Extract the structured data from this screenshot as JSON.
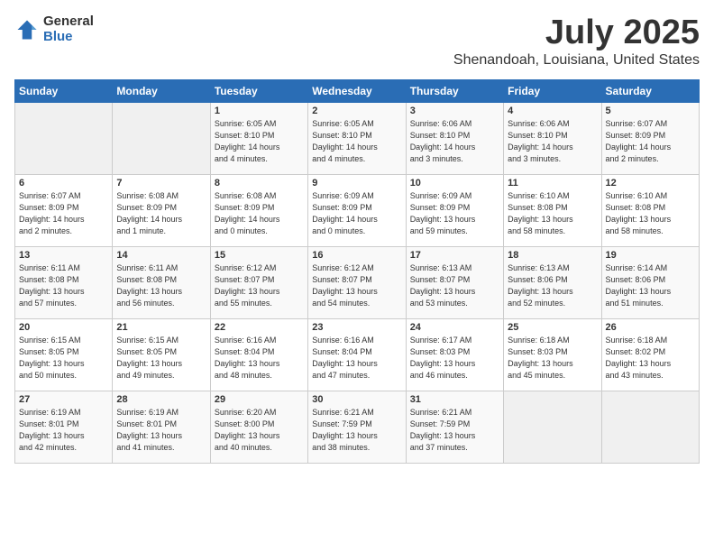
{
  "header": {
    "logo_general": "General",
    "logo_blue": "Blue",
    "title": "July 2025",
    "subtitle": "Shenandoah, Louisiana, United States"
  },
  "calendar": {
    "days_of_week": [
      "Sunday",
      "Monday",
      "Tuesday",
      "Wednesday",
      "Thursday",
      "Friday",
      "Saturday"
    ],
    "weeks": [
      [
        {
          "day": "",
          "info": ""
        },
        {
          "day": "",
          "info": ""
        },
        {
          "day": "1",
          "info": "Sunrise: 6:05 AM\nSunset: 8:10 PM\nDaylight: 14 hours\nand 4 minutes."
        },
        {
          "day": "2",
          "info": "Sunrise: 6:05 AM\nSunset: 8:10 PM\nDaylight: 14 hours\nand 4 minutes."
        },
        {
          "day": "3",
          "info": "Sunrise: 6:06 AM\nSunset: 8:10 PM\nDaylight: 14 hours\nand 3 minutes."
        },
        {
          "day": "4",
          "info": "Sunrise: 6:06 AM\nSunset: 8:10 PM\nDaylight: 14 hours\nand 3 minutes."
        },
        {
          "day": "5",
          "info": "Sunrise: 6:07 AM\nSunset: 8:09 PM\nDaylight: 14 hours\nand 2 minutes."
        }
      ],
      [
        {
          "day": "6",
          "info": "Sunrise: 6:07 AM\nSunset: 8:09 PM\nDaylight: 14 hours\nand 2 minutes."
        },
        {
          "day": "7",
          "info": "Sunrise: 6:08 AM\nSunset: 8:09 PM\nDaylight: 14 hours\nand 1 minute."
        },
        {
          "day": "8",
          "info": "Sunrise: 6:08 AM\nSunset: 8:09 PM\nDaylight: 14 hours\nand 0 minutes."
        },
        {
          "day": "9",
          "info": "Sunrise: 6:09 AM\nSunset: 8:09 PM\nDaylight: 14 hours\nand 0 minutes."
        },
        {
          "day": "10",
          "info": "Sunrise: 6:09 AM\nSunset: 8:09 PM\nDaylight: 13 hours\nand 59 minutes."
        },
        {
          "day": "11",
          "info": "Sunrise: 6:10 AM\nSunset: 8:08 PM\nDaylight: 13 hours\nand 58 minutes."
        },
        {
          "day": "12",
          "info": "Sunrise: 6:10 AM\nSunset: 8:08 PM\nDaylight: 13 hours\nand 58 minutes."
        }
      ],
      [
        {
          "day": "13",
          "info": "Sunrise: 6:11 AM\nSunset: 8:08 PM\nDaylight: 13 hours\nand 57 minutes."
        },
        {
          "day": "14",
          "info": "Sunrise: 6:11 AM\nSunset: 8:08 PM\nDaylight: 13 hours\nand 56 minutes."
        },
        {
          "day": "15",
          "info": "Sunrise: 6:12 AM\nSunset: 8:07 PM\nDaylight: 13 hours\nand 55 minutes."
        },
        {
          "day": "16",
          "info": "Sunrise: 6:12 AM\nSunset: 8:07 PM\nDaylight: 13 hours\nand 54 minutes."
        },
        {
          "day": "17",
          "info": "Sunrise: 6:13 AM\nSunset: 8:07 PM\nDaylight: 13 hours\nand 53 minutes."
        },
        {
          "day": "18",
          "info": "Sunrise: 6:13 AM\nSunset: 8:06 PM\nDaylight: 13 hours\nand 52 minutes."
        },
        {
          "day": "19",
          "info": "Sunrise: 6:14 AM\nSunset: 8:06 PM\nDaylight: 13 hours\nand 51 minutes."
        }
      ],
      [
        {
          "day": "20",
          "info": "Sunrise: 6:15 AM\nSunset: 8:05 PM\nDaylight: 13 hours\nand 50 minutes."
        },
        {
          "day": "21",
          "info": "Sunrise: 6:15 AM\nSunset: 8:05 PM\nDaylight: 13 hours\nand 49 minutes."
        },
        {
          "day": "22",
          "info": "Sunrise: 6:16 AM\nSunset: 8:04 PM\nDaylight: 13 hours\nand 48 minutes."
        },
        {
          "day": "23",
          "info": "Sunrise: 6:16 AM\nSunset: 8:04 PM\nDaylight: 13 hours\nand 47 minutes."
        },
        {
          "day": "24",
          "info": "Sunrise: 6:17 AM\nSunset: 8:03 PM\nDaylight: 13 hours\nand 46 minutes."
        },
        {
          "day": "25",
          "info": "Sunrise: 6:18 AM\nSunset: 8:03 PM\nDaylight: 13 hours\nand 45 minutes."
        },
        {
          "day": "26",
          "info": "Sunrise: 6:18 AM\nSunset: 8:02 PM\nDaylight: 13 hours\nand 43 minutes."
        }
      ],
      [
        {
          "day": "27",
          "info": "Sunrise: 6:19 AM\nSunset: 8:01 PM\nDaylight: 13 hours\nand 42 minutes."
        },
        {
          "day": "28",
          "info": "Sunrise: 6:19 AM\nSunset: 8:01 PM\nDaylight: 13 hours\nand 41 minutes."
        },
        {
          "day": "29",
          "info": "Sunrise: 6:20 AM\nSunset: 8:00 PM\nDaylight: 13 hours\nand 40 minutes."
        },
        {
          "day": "30",
          "info": "Sunrise: 6:21 AM\nSunset: 7:59 PM\nDaylight: 13 hours\nand 38 minutes."
        },
        {
          "day": "31",
          "info": "Sunrise: 6:21 AM\nSunset: 7:59 PM\nDaylight: 13 hours\nand 37 minutes."
        },
        {
          "day": "",
          "info": ""
        },
        {
          "day": "",
          "info": ""
        }
      ]
    ]
  }
}
